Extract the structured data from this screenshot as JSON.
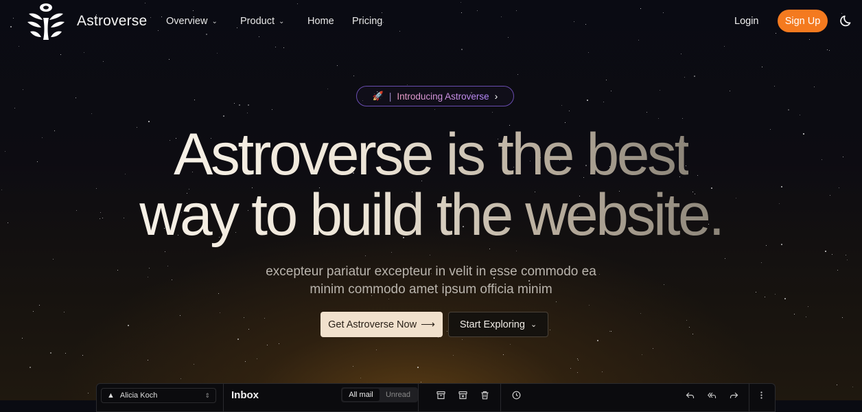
{
  "nav": {
    "brand": "Astroverse",
    "items": [
      {
        "label": "Overview",
        "has_dropdown": true
      },
      {
        "label": "Product",
        "has_dropdown": true
      },
      {
        "label": "Home",
        "has_dropdown": false
      },
      {
        "label": "Pricing",
        "has_dropdown": false
      }
    ],
    "login_label": "Login",
    "signup_label": "Sign Up",
    "theme_icon": "moon-icon"
  },
  "hero": {
    "badge_icon": "rocket-icon",
    "badge_separator": "|",
    "badge_text": "Introducing Astroverse",
    "headline_line1": "Astroverse is the best",
    "headline_line2": "way to build the website.",
    "subtitle_line1": "excepteur pariatur excepteur in velit in esse commodo ea",
    "subtitle_line2": "minim commodo amet ipsum officia minim",
    "primary_button": "Get Astroverse Now",
    "primary_arrow": "⟶",
    "secondary_button": "Start Exploring"
  },
  "preview": {
    "account_name": "Alicia Koch",
    "title": "Inbox",
    "tabs": [
      "All mail",
      "Unread"
    ],
    "active_tab": "All mail"
  },
  "colors": {
    "accent": "#f47a1f",
    "badge_border": "#6a4db0",
    "primary_button_bg": "#f1e1cd"
  }
}
